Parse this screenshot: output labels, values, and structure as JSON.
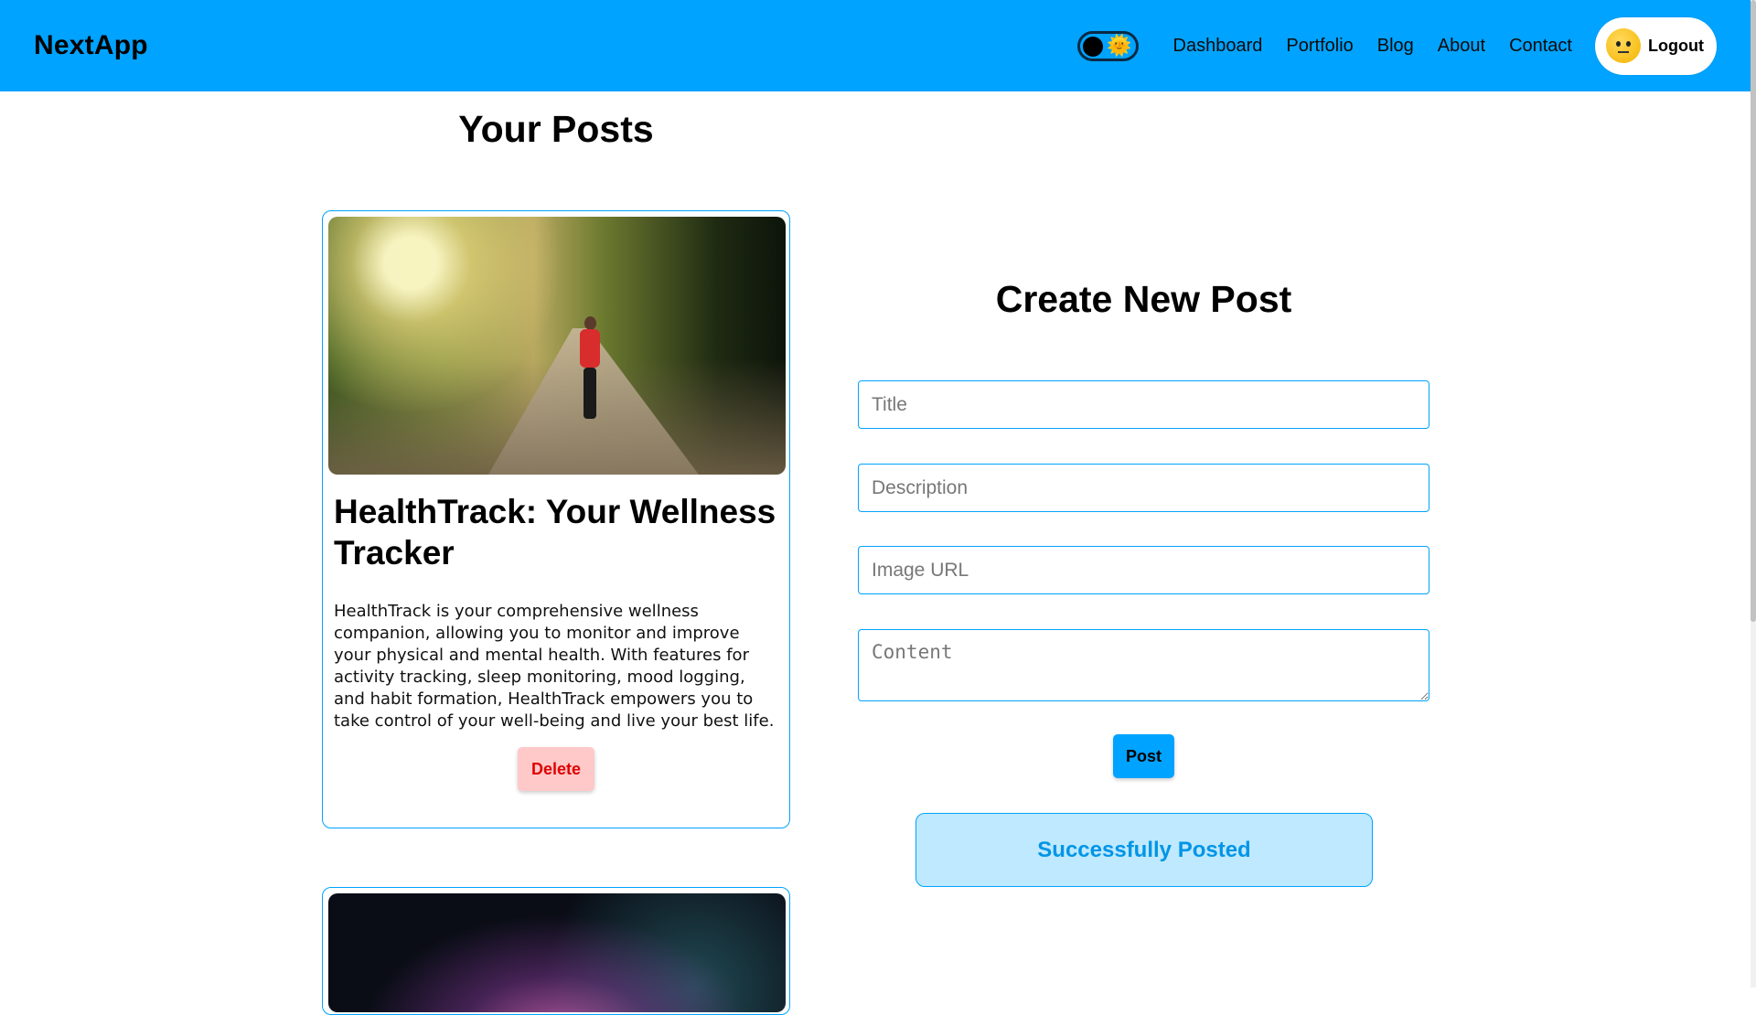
{
  "navbar": {
    "brand": "NextApp",
    "theme_toggle": {
      "knob_icon": "moon-knob-icon",
      "sun_icon": "sun-icon",
      "sun_glyph": "🌞"
    },
    "links": [
      "Dashboard",
      "Portfolio",
      "Blog",
      "About",
      "Contact"
    ],
    "logout_label": "Logout",
    "avatar_icon": "avatar-face-icon"
  },
  "posts": {
    "heading": "Your Posts",
    "items": [
      {
        "title": "HealthTrack: Your Wellness Tracker",
        "description": "HealthTrack is your comprehensive wellness companion, allowing you to monitor and improve your physical and mental health. With features for activity tracking, sleep monitoring, mood logging, and habit formation, HealthTrack empowers you to take control of your well-being and live your best life.",
        "delete_label": "Delete"
      },
      {
        "title": "",
        "description": ""
      }
    ]
  },
  "create_form": {
    "heading": "Create New Post",
    "title_placeholder": "Title",
    "description_placeholder": "Description",
    "image_placeholder": "Image URL",
    "content_placeholder": "Content",
    "post_label": "Post",
    "success_message": "Successfully Posted"
  },
  "colors": {
    "accent": "#00a3ff",
    "delete_bg": "#ffc9c9",
    "delete_text": "#e00000",
    "success_bg": "#bfe9ff"
  }
}
